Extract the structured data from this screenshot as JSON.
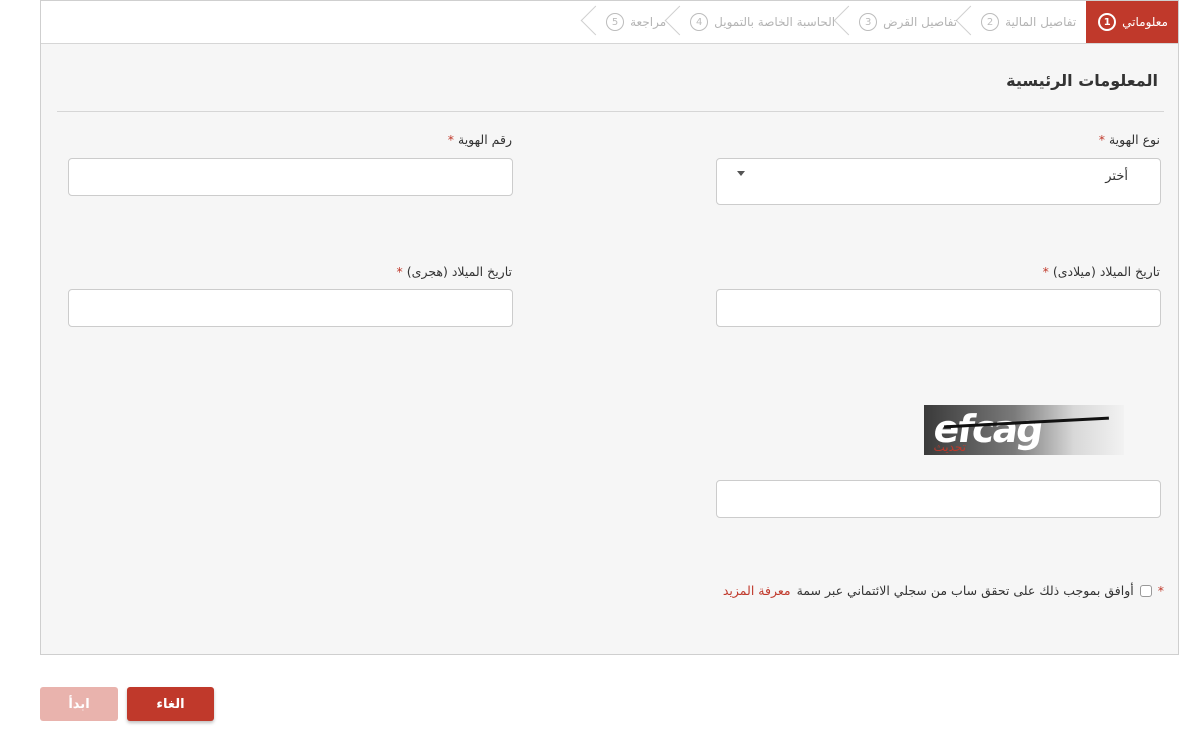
{
  "steps": [
    {
      "num": "1",
      "label": "معلوماتي",
      "active": true
    },
    {
      "num": "2",
      "label": "تفاصيل المالية",
      "active": false
    },
    {
      "num": "3",
      "label": "تفاصيل القرض",
      "active": false
    },
    {
      "num": "4",
      "label": "الحاسبة الخاصة بالتمويل",
      "active": false
    },
    {
      "num": "5",
      "label": "مراجعة",
      "active": false
    }
  ],
  "form": {
    "section_title": "المعلومات الرئيسية",
    "id_type": {
      "label": "نوع الهوية",
      "required_mark": "*",
      "selected": "أختر"
    },
    "id_number": {
      "label": "رقم الهوية",
      "required_mark": "*",
      "value": ""
    },
    "birth_gregorian": {
      "label": "تاريخ الميلاد (ميلادى)",
      "required_mark": "*",
      "value": ""
    },
    "birth_hijri": {
      "label": "تاريخ الميلاد (هجرى)",
      "required_mark": "*",
      "value": ""
    },
    "captcha": {
      "text": "efcag",
      "refresh_label": "تحديث",
      "value": ""
    },
    "consent": {
      "required_mark": "*",
      "text": "أوافق بموجب ذلك على تحقق ساب من سجلي الائتماني عبر سمة",
      "link_text": "معرفة المزيد",
      "checked": false
    }
  },
  "actions": {
    "cancel_label": "الغاء",
    "start_label": "ابدأ"
  },
  "colors": {
    "accent": "#c0392b",
    "accent_disabled": "#e9b3ad",
    "panel_bg": "#f6f6f6"
  }
}
